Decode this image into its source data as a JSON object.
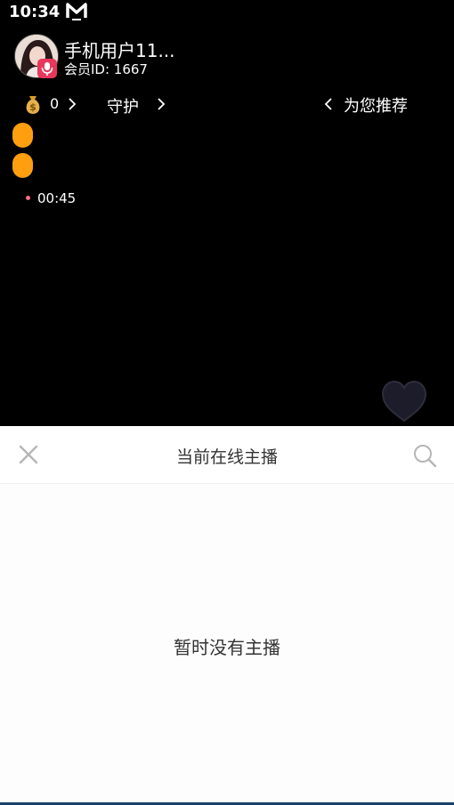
{
  "status_bar": {
    "time": "10:34",
    "app_icon": "m-app-icon"
  },
  "anchor": {
    "name": "手机用户11...",
    "member_id": "会员ID: 1667",
    "avatar_icon": "avatar-photo",
    "badge_icon": "microphone-icon",
    "badge_color": "#e8375b"
  },
  "stats": {
    "coin_icon": "money-bag-icon",
    "coin_count": "0",
    "guard_label": "守护"
  },
  "recommend": {
    "label": "为您推荐"
  },
  "live": {
    "timer": "00:45",
    "accent_color": "#ff9f0f",
    "heart_icon": "heart-icon"
  },
  "panel": {
    "title": "当前在线主播",
    "empty_message": "暂时没有主播",
    "close_icon": "close-icon",
    "search_icon": "search-icon"
  }
}
